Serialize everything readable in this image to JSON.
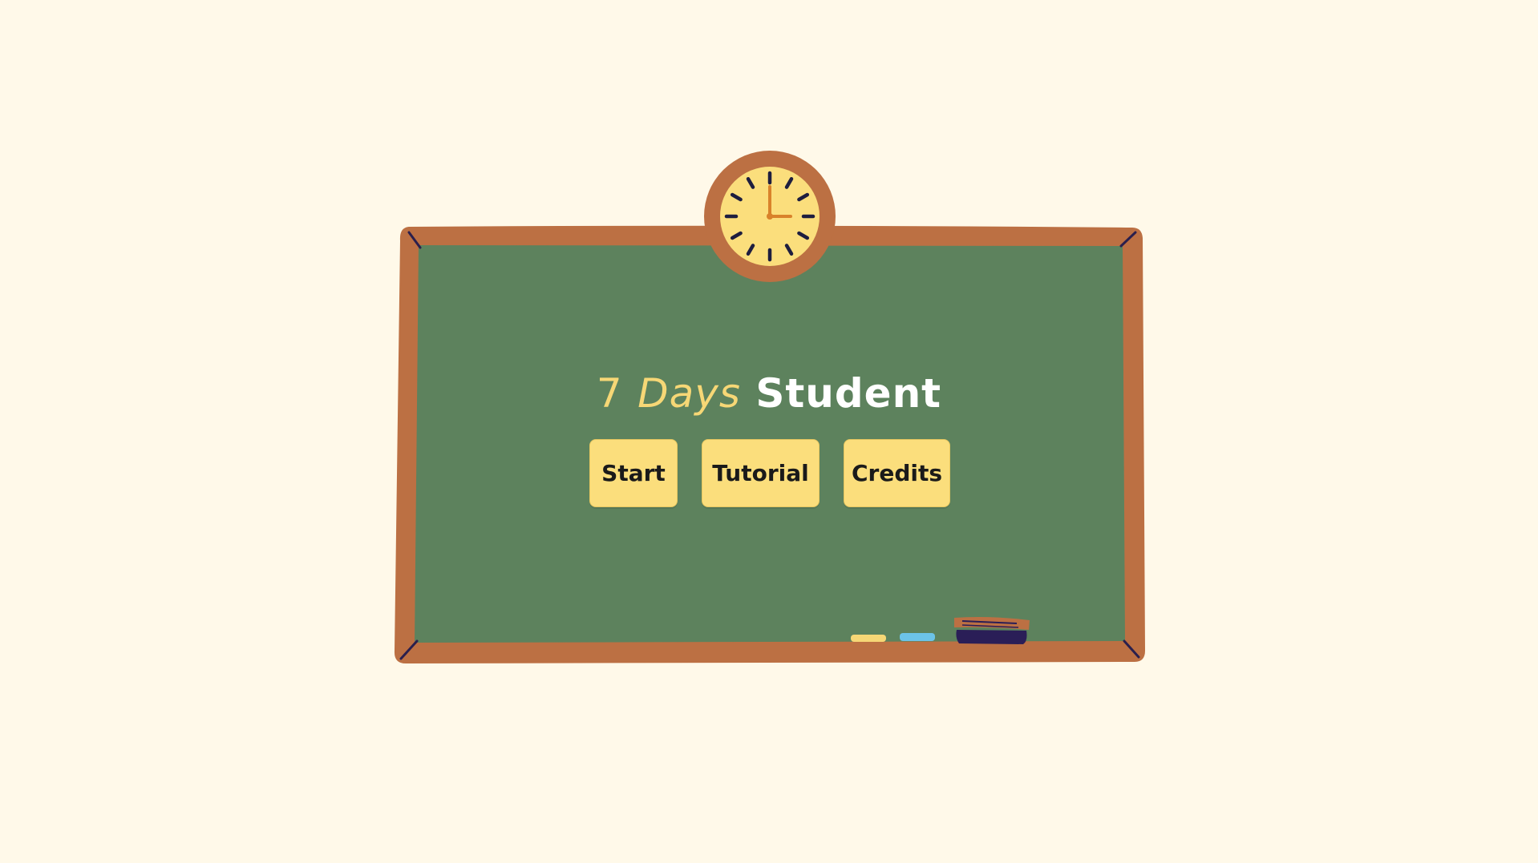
{
  "title": {
    "part1": "7",
    "part2": "Days",
    "part3": "Student"
  },
  "menu": {
    "start_label": "Start",
    "tutorial_label": "Tutorial",
    "credits_label": "Credits"
  },
  "colors": {
    "background": "#FFF9E9",
    "board": "#5D825D",
    "frame": "#BC7043",
    "button": "#FBDE7C",
    "title_accent": "#F6D776",
    "title_main": "#FFFFFF"
  },
  "clock": {
    "hour": 3,
    "minute": 0
  }
}
